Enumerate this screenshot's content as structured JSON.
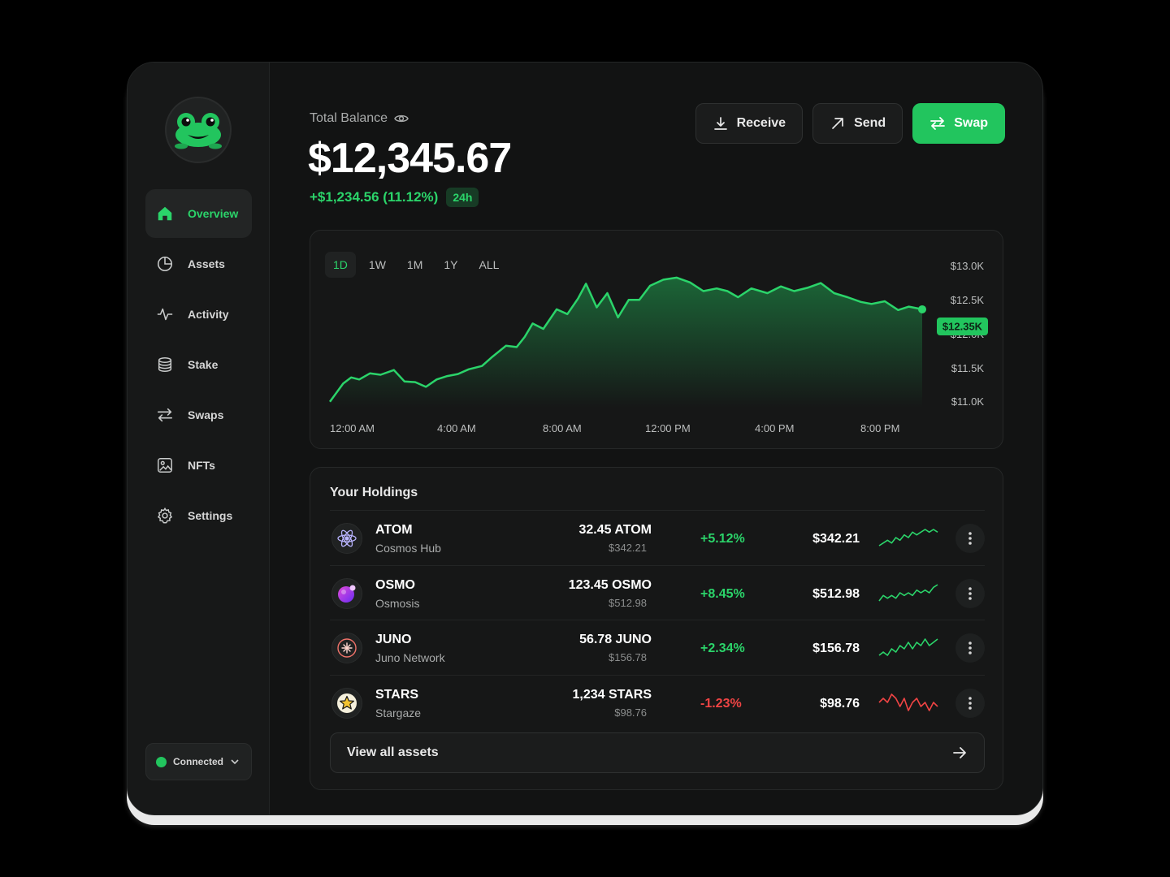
{
  "sidebar": {
    "items": [
      {
        "label": "Overview",
        "icon": "home-icon",
        "active": true
      },
      {
        "label": "Assets",
        "icon": "pie-chart-icon"
      },
      {
        "label": "Activity",
        "icon": "activity-icon"
      },
      {
        "label": "Stake",
        "icon": "coins-icon"
      },
      {
        "label": "Swaps",
        "icon": "swap-icon"
      },
      {
        "label": "NFTs",
        "icon": "image-icon"
      },
      {
        "label": "Settings",
        "icon": "gear-icon"
      }
    ],
    "connection": {
      "label": "Connected",
      "status_color": "#22c55e"
    }
  },
  "balance": {
    "label": "Total Balance",
    "value": "$12,345.67",
    "change": "+$1,234.56 (11.12%)",
    "period": "24h"
  },
  "actions": {
    "receive": "Receive",
    "send": "Send",
    "swap": "Swap"
  },
  "chart": {
    "ranges": [
      "1D",
      "1W",
      "1M",
      "1Y",
      "ALL"
    ],
    "active_range": "1D",
    "current_label": "$12.35K"
  },
  "chart_data": {
    "type": "area",
    "x_ticks": [
      "12:00 AM",
      "4:00 AM",
      "8:00 AM",
      "12:00 PM",
      "4:00 PM",
      "8:00 PM"
    ],
    "y_ticks": [
      "$13.0K",
      "$12.5K",
      "$12.0K",
      "$11.5K",
      "$11.0K"
    ],
    "ylim": [
      11000,
      13000
    ],
    "xlim": [
      0,
      22.2
    ],
    "x": [
      0,
      0.5,
      0.8,
      1.1,
      1.5,
      1.9,
      2.4,
      2.8,
      3.2,
      3.6,
      4.0,
      4.4,
      4.8,
      5.2,
      5.7,
      6.1,
      6.6,
      7.0,
      7.3,
      7.6,
      8.0,
      8.5,
      8.9,
      9.3,
      9.6,
      10.0,
      10.4,
      10.8,
      11.2,
      11.6,
      12.0,
      12.5,
      13.0,
      13.5,
      14.0,
      14.5,
      14.9,
      15.3,
      15.8,
      16.4,
      16.9,
      17.4,
      17.9,
      18.4,
      18.9,
      19.4,
      19.9,
      20.3,
      20.8,
      21.3,
      21.7,
      22.2
    ],
    "y": [
      10980,
      11250,
      11340,
      11310,
      11400,
      11380,
      11450,
      11280,
      11270,
      11200,
      11310,
      11360,
      11390,
      11460,
      11510,
      11650,
      11810,
      11790,
      11940,
      12140,
      12060,
      12350,
      12280,
      12510,
      12730,
      12380,
      12590,
      12230,
      12490,
      12490,
      12700,
      12790,
      12820,
      12750,
      12620,
      12660,
      12620,
      12530,
      12660,
      12590,
      12690,
      12620,
      12670,
      12740,
      12590,
      12530,
      12460,
      12430,
      12470,
      12340,
      12390,
      12350
    ],
    "title": "",
    "xlabel": "",
    "ylabel": "",
    "grid": false,
    "line_color": "#2bd46a"
  },
  "holdings": {
    "title": "Your Holdings",
    "rows": [
      {
        "symbol": "ATOM",
        "network": "Cosmos Hub",
        "amount": "32.45 ATOM",
        "amount_usd": "$342.21",
        "change": "+5.12%",
        "direction": "up",
        "value": "$342.21",
        "icon": "atom-icon",
        "spark": [
          3,
          4,
          5,
          4,
          6,
          5,
          7,
          6,
          8,
          7,
          8,
          9,
          8,
          9,
          8
        ]
      },
      {
        "symbol": "OSMO",
        "network": "Osmosis",
        "amount": "123.45 OSMO",
        "amount_usd": "$512.98",
        "change": "+8.45%",
        "direction": "up",
        "value": "$512.98",
        "icon": "osmosis-icon",
        "spark": [
          3,
          5,
          4,
          5,
          4,
          6,
          5,
          6,
          5,
          7,
          6,
          7,
          6,
          8,
          9
        ]
      },
      {
        "symbol": "JUNO",
        "network": "Juno Network",
        "amount": "56.78 JUNO",
        "amount_usd": "$156.78",
        "change": "+2.34%",
        "direction": "up",
        "value": "$156.78",
        "icon": "juno-icon",
        "spark": [
          3,
          4,
          3,
          5,
          4,
          6,
          5,
          7,
          5,
          7,
          6,
          8,
          6,
          7,
          8
        ]
      },
      {
        "symbol": "STARS",
        "network": "Stargaze",
        "amount": "1,234 STARS",
        "amount_usd": "$98.76",
        "change": "-1.23%",
        "direction": "down",
        "value": "$98.76",
        "icon": "star-icon",
        "spark": [
          6,
          7,
          6,
          8,
          7,
          5,
          7,
          4,
          6,
          7,
          5,
          6,
          4,
          6,
          5
        ]
      }
    ],
    "view_all": "View all assets"
  },
  "colors": {
    "accent": "#22c55e",
    "positive": "#2bd46a",
    "negative": "#ef4444",
    "background": "#121313"
  }
}
